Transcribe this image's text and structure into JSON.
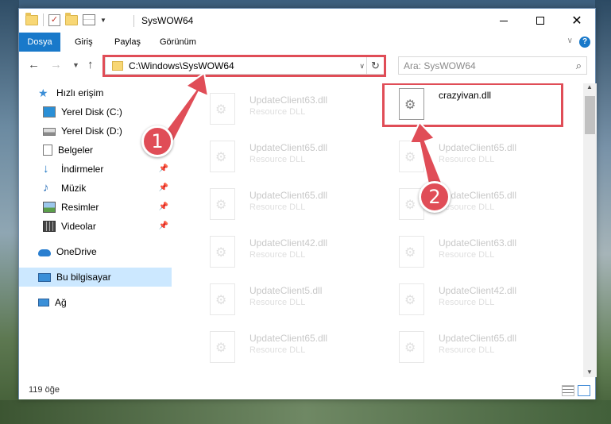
{
  "window": {
    "title": "SysWOW64"
  },
  "ribbon": {
    "tabs": [
      {
        "label": "Dosya"
      },
      {
        "label": "Giriş"
      },
      {
        "label": "Paylaş"
      },
      {
        "label": "Görünüm"
      }
    ],
    "help": "?"
  },
  "nav": {
    "address": "C:\\Windows\\SysWOW64",
    "search_placeholder": "Ara: SysWOW64"
  },
  "sidebar": {
    "items": [
      {
        "label": "Hızlı erişim",
        "icon": "star-icon"
      },
      {
        "label": "Yerel Disk (C:)",
        "icon": "windows-drive-icon"
      },
      {
        "label": "Yerel Disk (D:)",
        "icon": "drive-icon"
      },
      {
        "label": "Belgeler",
        "icon": "documents-icon"
      },
      {
        "label": "İndirmeler",
        "icon": "download-icon",
        "pinned": true
      },
      {
        "label": "Müzik",
        "icon": "music-icon",
        "pinned": true
      },
      {
        "label": "Resimler",
        "icon": "pictures-icon",
        "pinned": true
      },
      {
        "label": "Videolar",
        "icon": "videos-icon",
        "pinned": true
      },
      {
        "label": "OneDrive",
        "icon": "cloud-icon"
      },
      {
        "label": "Bu bilgisayar",
        "icon": "computer-icon",
        "selected": true
      },
      {
        "label": "Ağ",
        "icon": "network-icon"
      }
    ]
  },
  "files": [
    {
      "name": "UpdateClient63.dll",
      "desc": "Resource DLL",
      "faded": true
    },
    {
      "name": "crazyivan.dll",
      "desc": "",
      "faded": false,
      "highlighted": true
    },
    {
      "name": "UpdateClient65.dll",
      "desc": "Resource DLL",
      "faded": true
    },
    {
      "name": "UpdateClient65.dll",
      "desc": "Resource DLL",
      "faded": true
    },
    {
      "name": "UpdateClient65.dll",
      "desc": "Resource DLL",
      "faded": true
    },
    {
      "name": "UpdateClient65.dll",
      "desc": "Resource DLL",
      "faded": true
    },
    {
      "name": "UpdateClient42.dll",
      "desc": "Resource DLL",
      "faded": true
    },
    {
      "name": "UpdateClient63.dll",
      "desc": "Resource DLL",
      "faded": true
    },
    {
      "name": "UpdateClient5.dll",
      "desc": "Resource DLL",
      "faded": true
    },
    {
      "name": "UpdateClient42.dll",
      "desc": "Resource DLL",
      "faded": true
    },
    {
      "name": "UpdateClient65.dll",
      "desc": "Resource DLL",
      "faded": true
    },
    {
      "name": "UpdateClient65.dll",
      "desc": "Resource DLL",
      "faded": true
    }
  ],
  "status": {
    "item_count": "119 öğe"
  },
  "annotations": {
    "step1": "1",
    "step2": "2",
    "color": "#e04d57"
  }
}
